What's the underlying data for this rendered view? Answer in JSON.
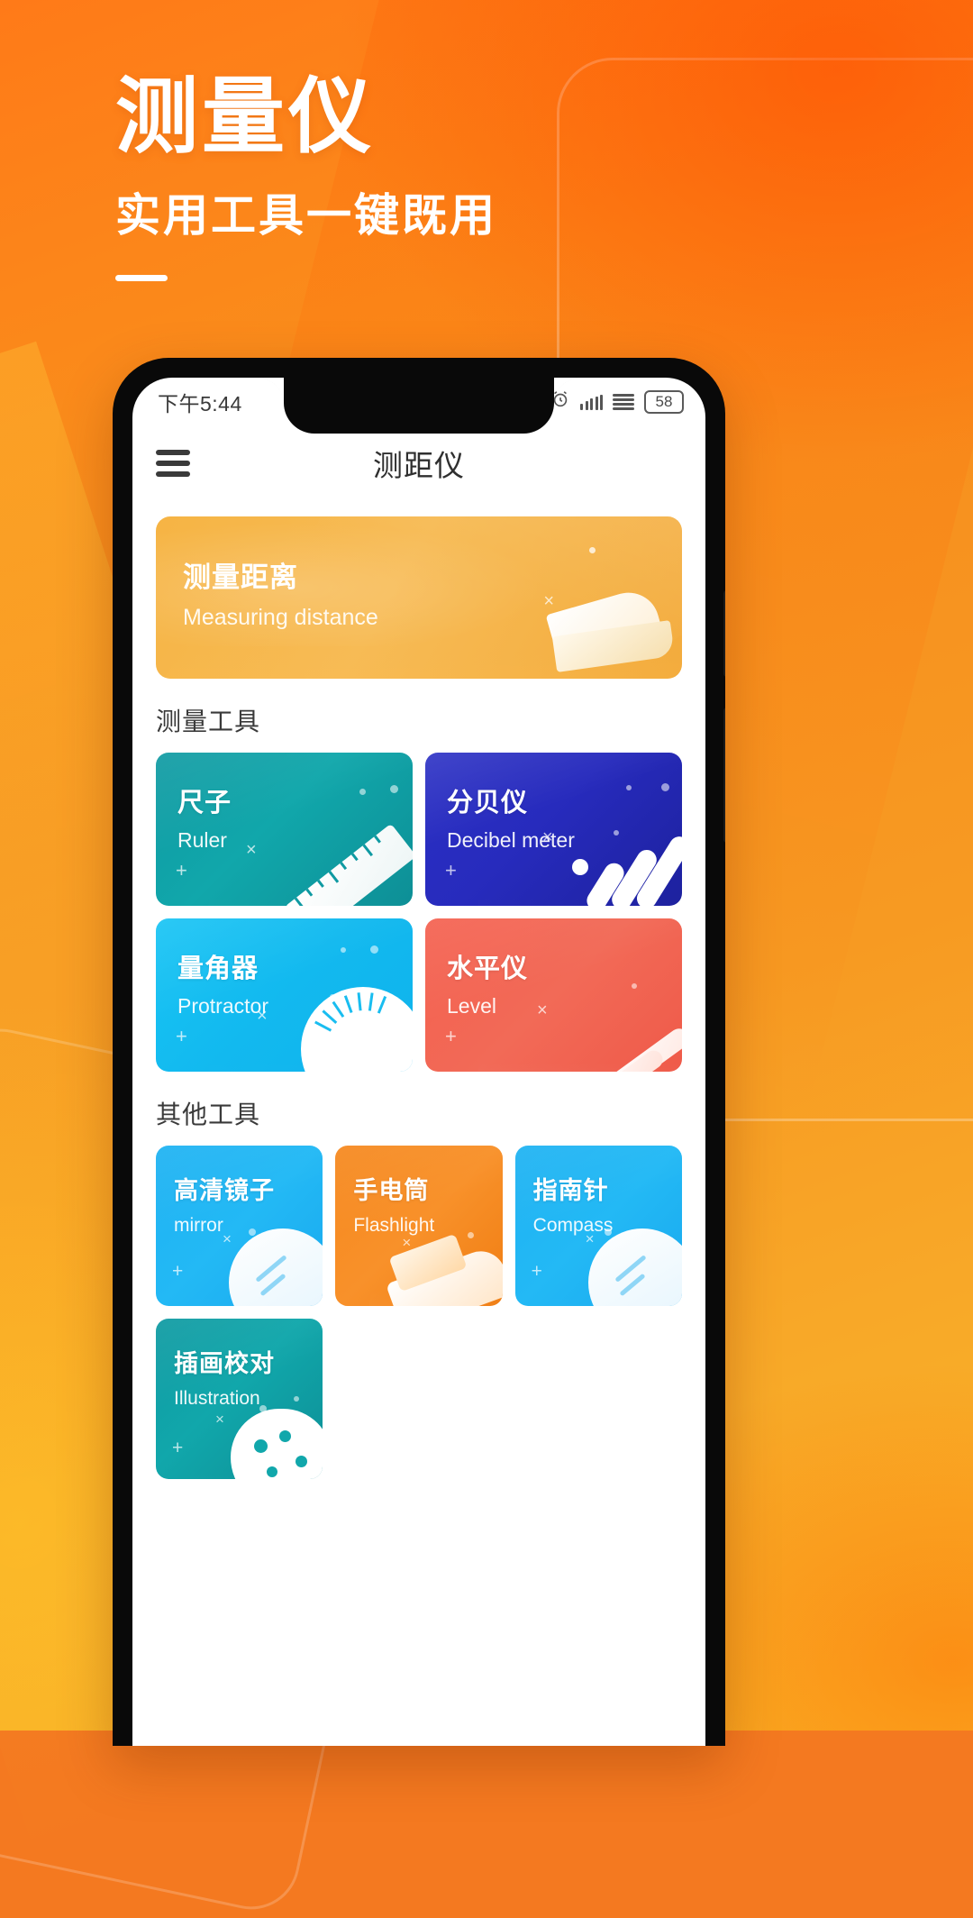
{
  "promo": {
    "title": "测量仪",
    "subtitle": "实用工具一键既用",
    "accent": "#ffffff",
    "bg_start": "#ff7a18",
    "bg_end": "#f9b826"
  },
  "status_bar": {
    "time": "下午5:44",
    "alarm_icon": "alarm-clock-icon",
    "signal_bars_icon": "signal-bars-icon",
    "wifi_icon": "network-lines-icon",
    "battery_level": "58"
  },
  "app_bar": {
    "menu_icon": "hamburger-menu-icon",
    "title": "测距仪"
  },
  "banner": {
    "title_cn": "测量距离",
    "title_en": "Measuring distance",
    "color": "#f6b444"
  },
  "sections": [
    {
      "heading": "测量工具",
      "cards": [
        {
          "cn": "尺子",
          "en": "Ruler",
          "theme": "t-ruler",
          "color": "#11a7ab",
          "art": "ruler"
        },
        {
          "cn": "分贝仪",
          "en": "Decibel meter",
          "theme": "t-decibel",
          "color": "#272bbd",
          "art": "decibel"
        },
        {
          "cn": "量角器",
          "en": "Protractor",
          "theme": "t-protractor",
          "color": "#12b9ef",
          "art": "protractor"
        },
        {
          "cn": "水平仪",
          "en": "Level",
          "theme": "t-level",
          "color": "#f26a57",
          "art": "level"
        }
      ]
    },
    {
      "heading": "其他工具",
      "cards": [
        {
          "cn": "高清镜子",
          "en": "mirror",
          "theme": "t-mirror",
          "color": "#23b9f5",
          "art": "mirror"
        },
        {
          "cn": "手电筒",
          "en": "Flashlight",
          "theme": "t-flash",
          "color": "#f8912a",
          "art": "flashlight"
        },
        {
          "cn": "指南针",
          "en": "Compass",
          "theme": "t-compass",
          "color": "#23b9f5",
          "art": "compass"
        },
        {
          "cn": "插画校对",
          "en": "Illustration",
          "theme": "t-illus",
          "color": "#11a7ab",
          "art": "palette"
        }
      ]
    }
  ]
}
